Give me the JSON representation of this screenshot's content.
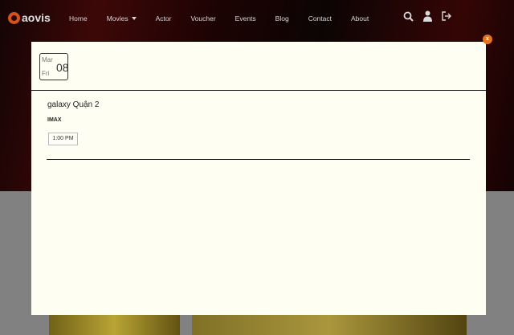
{
  "brand": {
    "name": "aovis"
  },
  "nav": {
    "items": [
      {
        "label": "Home"
      },
      {
        "label": "Movies"
      },
      {
        "label": "Actor"
      },
      {
        "label": "Voucher"
      },
      {
        "label": "Events"
      },
      {
        "label": "Blog"
      },
      {
        "label": "Contact"
      },
      {
        "label": "About"
      }
    ],
    "icons": [
      "search-icon",
      "user-icon",
      "logout-icon"
    ]
  },
  "modal": {
    "close_label": "x",
    "date": {
      "month": "Mar",
      "weekday": "Fri",
      "day": "08"
    },
    "cinema": "galaxy Quận 2",
    "format": "IMAX",
    "times": [
      "1:00 PM"
    ]
  },
  "colors": {
    "accent": "#e8731b",
    "modal_bg": "#fefef2"
  }
}
